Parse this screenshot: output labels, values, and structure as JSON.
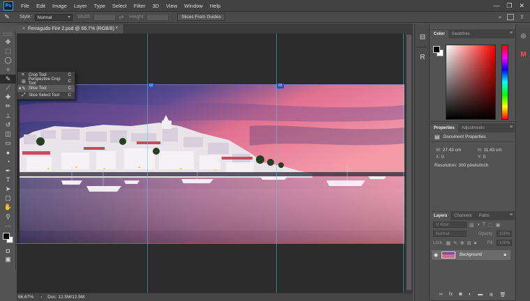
{
  "app": {
    "logo": "Ps"
  },
  "menu": [
    "File",
    "Edit",
    "Image",
    "Layer",
    "Type",
    "Select",
    "Filter",
    "3D",
    "View",
    "Window",
    "Help"
  ],
  "window_controls": {
    "minimize": "—",
    "restore": "❐",
    "close": "✕"
  },
  "options_bar": {
    "style_label": "Style:",
    "style_value": "Normal",
    "width_label": "Width:",
    "height_label": "Height:",
    "slices_button": "Slices From Guides"
  },
  "document": {
    "tab_title": "Ferragudo Fire 2.psd @ 66.7% (RGB/8) *",
    "close": "×"
  },
  "status": {
    "zoom": "66.67%",
    "doc_size": "Doc: 12.5M/12.5M"
  },
  "flyout": [
    {
      "label": "Crop Tool",
      "shortcut": "C",
      "icon": "crop-icon",
      "selected": false
    },
    {
      "label": "Perspective Crop Tool",
      "shortcut": "C",
      "icon": "perspective-crop-icon",
      "selected": false
    },
    {
      "label": "Slice Tool",
      "shortcut": "C",
      "icon": "slice-icon",
      "selected": true
    },
    {
      "label": "Slice Select Tool",
      "shortcut": "C",
      "icon": "slice-select-icon",
      "selected": false
    }
  ],
  "slice_labels": [
    "02",
    "03"
  ],
  "panels": {
    "color": {
      "tabs": [
        "Color",
        "Swatches"
      ]
    },
    "properties": {
      "tabs": [
        "Properties",
        "Adjustments"
      ],
      "heading": "Document Properties",
      "w_label": "W:",
      "w_value": "27.43 cm",
      "h_label": "H:",
      "h_value": "11.43 cm",
      "x_label": "X:",
      "x_value": "0",
      "y_label": "Y:",
      "y_value": "0",
      "resolution": "Resolution: 300 pixels/inch"
    },
    "layers": {
      "tabs": [
        "Layers",
        "Channels",
        "Paths"
      ],
      "kind_placeholder": "Kind",
      "blend_mode": "Normal",
      "opacity_label": "Opacity:",
      "opacity_value": "100%",
      "lock_label": "Lock:",
      "fill_label": "Fill:",
      "fill_value": "100%",
      "layer_name": "Background"
    }
  },
  "colors": {
    "accent": "#31a8ff",
    "foreground": "#000000",
    "background": "#ffffff",
    "slice_tag": "#1f4fcf",
    "guide": "#47d6d6"
  }
}
